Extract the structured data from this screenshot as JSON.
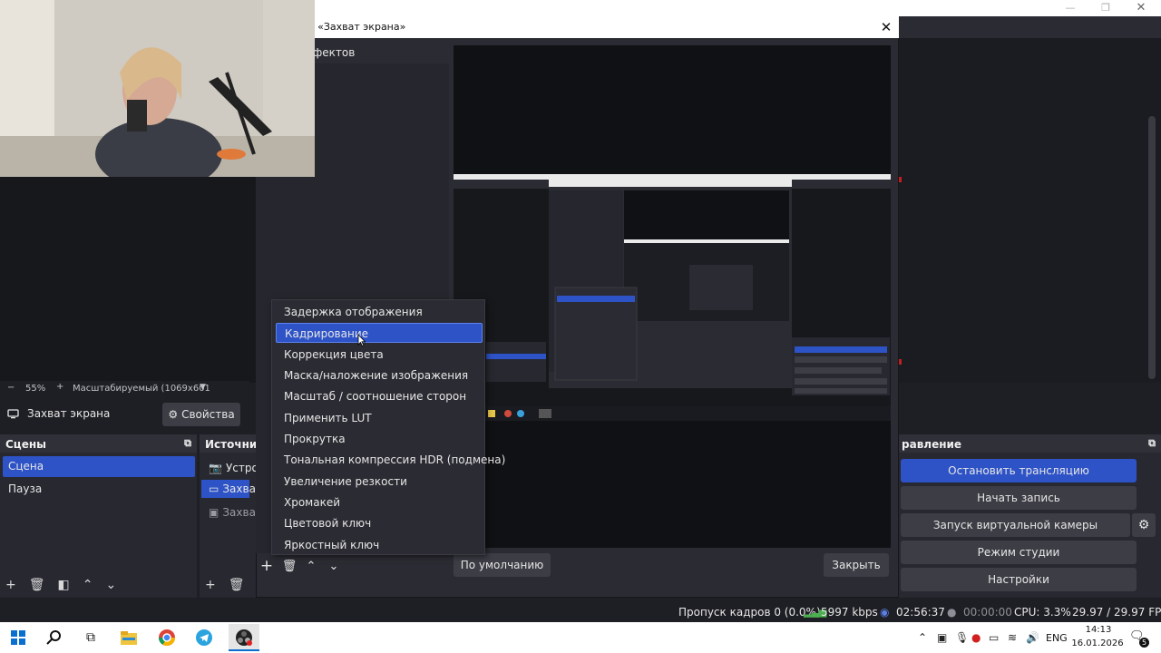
{
  "dialog": {
    "title": "я «Захват экрана»",
    "effects_label": "фектов",
    "default_button": "По умолчанию",
    "close_button": "Закрыть"
  },
  "filter_menu": {
    "items": [
      "Задержка отображения",
      "Кадрирование",
      "Коррекция цвета",
      "Маска/наложение изображения",
      "Масштаб / соотношение сторон",
      "Применить LUT",
      "Прокрутка",
      "Тональная компрессия HDR (подмена)",
      "Увеличение резкости",
      "Хромакей",
      "Цветовой ключ",
      "Яркостный ключ"
    ],
    "selected": "Кадрирование"
  },
  "preview_zoom": {
    "minus": "−",
    "value": "55%",
    "plus": "+",
    "mode": "Масштабируемый (1069x601"
  },
  "source_toolbar": {
    "source_name": "Захват экрана",
    "properties_button": "Свойства"
  },
  "scenes": {
    "title": "Сцены",
    "items": [
      "Сцена",
      "Пауза"
    ],
    "selected": "Сцена"
  },
  "sources": {
    "title": "Источни",
    "items": [
      "Устро",
      "Захва",
      "Захва"
    ]
  },
  "controls": {
    "title": "равление",
    "stop_stream": "Остановить трансляцию",
    "start_record": "Начать запись",
    "start_vcam": "Запуск виртуальной камеры",
    "studio_mode": "Режим студии",
    "settings": "Настройки"
  },
  "status": {
    "dropped_frames": "Пропуск кадров 0 (0.0%)",
    "bitrate": "5997 kbps",
    "stream_time": "02:56:37",
    "record_time": "00:00:00",
    "cpu": "CPU: 3.3%",
    "fps": "29.97 / 29.97 FPS"
  },
  "taskbar": {
    "time": "14:13",
    "date": "16.01.2026",
    "lang": "ENG",
    "notifications": "5"
  },
  "colors": {
    "accent": "#2e53c7",
    "panel": "#272830",
    "background": "#1e1f24"
  },
  "icons": [
    "windows-start-icon",
    "search-icon",
    "task-view-icon",
    "file-explorer-icon",
    "chrome-icon",
    "telegram-icon",
    "obs-icon",
    "gear-icon",
    "camera-icon",
    "monitor-icon",
    "plus-icon",
    "trash-icon",
    "up-icon",
    "down-icon"
  ]
}
